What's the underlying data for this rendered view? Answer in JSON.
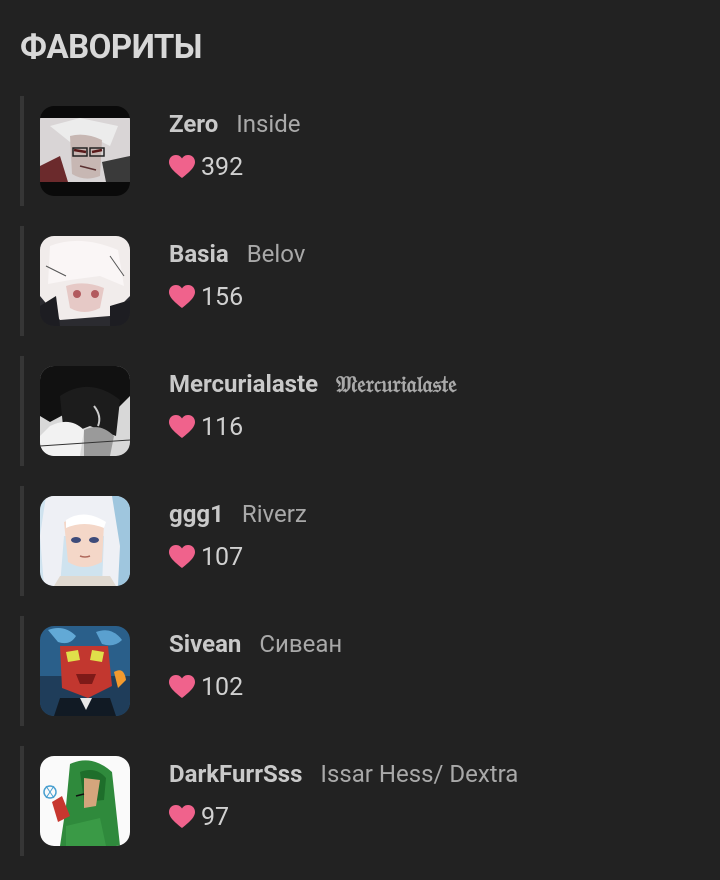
{
  "section": {
    "title": "ФАВОРИТЫ"
  },
  "colors": {
    "background": "#222222",
    "heart": "#f0628c",
    "divider": "#363636"
  },
  "favorites": [
    {
      "username": "Zero",
      "display_name": "Inside",
      "likes": "392",
      "avatar": "avatar-zero-icon"
    },
    {
      "username": "Basia",
      "display_name": "Belov",
      "likes": "156",
      "avatar": "avatar-basia-icon"
    },
    {
      "username": "Mercurialaste",
      "display_name": "𝔐𝔢𝔯𝔠𝔲𝔯𝔦𝔞𝔩𝔞𝔰𝔱𝔢",
      "likes": "116",
      "avatar": "avatar-mercurialaste-icon"
    },
    {
      "username": "ggg1",
      "display_name": "Riverz",
      "likes": "107",
      "avatar": "avatar-ggg1-icon"
    },
    {
      "username": "Sivean",
      "display_name": "Сивеан",
      "likes": "102",
      "avatar": "avatar-sivean-icon"
    },
    {
      "username": "DarkFurrSss",
      "display_name": "Issar Hess/ Dextra",
      "likes": "97",
      "avatar": "avatar-darkfurrsss-icon"
    }
  ]
}
